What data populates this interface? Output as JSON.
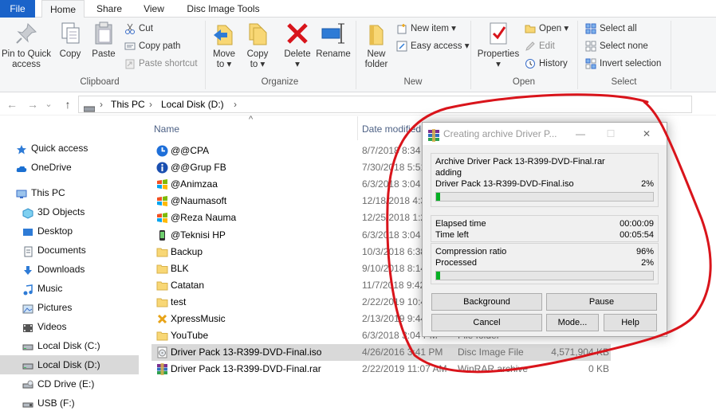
{
  "ribbon_tabs": [
    "File",
    "Home",
    "Share",
    "View",
    "Disc Image Tools"
  ],
  "clipboard": {
    "pin_line1": "Pin to Quick",
    "pin_line2": "access",
    "copy": "Copy",
    "paste": "Paste",
    "cut": "Cut",
    "copy_path": "Copy path",
    "paste_shortcut": "Paste shortcut",
    "label": "Clipboard"
  },
  "organize": {
    "move_line1": "Move",
    "move_line2": "to ▾",
    "copy_line1": "Copy",
    "copy_line2": "to ▾",
    "delete_line1": "Delete",
    "delete_line2": "▾",
    "rename": "Rename",
    "label": "Organize"
  },
  "new_group": {
    "folder_line1": "New",
    "folder_line2": "folder",
    "new_item": "New item ▾",
    "easy_access": "Easy access ▾",
    "label": "New"
  },
  "open_group": {
    "properties": "Properties",
    "properties_arrow": "▾",
    "open": "Open ▾",
    "edit": "Edit",
    "history": "History",
    "label": "Open"
  },
  "select_group": {
    "select_all": "Select all",
    "select_none": "Select none",
    "invert": "Invert selection",
    "label": "Select"
  },
  "address": {
    "back": "←",
    "forward": "→",
    "recent": "⌄",
    "up": "↑",
    "sep1": "›",
    "this_pc": "This PC",
    "sep2": "›",
    "local_disk": "Local Disk (D:)",
    "sep3": "›"
  },
  "nav": [
    {
      "label": "Quick access",
      "icon": "star-icon",
      "indent": 1
    },
    {
      "label": "OneDrive",
      "icon": "cloud-icon",
      "indent": 1
    },
    {
      "label": "This PC",
      "icon": "monitor-icon",
      "indent": 1
    },
    {
      "label": "3D Objects",
      "icon": "cube-icon",
      "indent": 2
    },
    {
      "label": "Desktop",
      "icon": "desktop-icon",
      "indent": 2
    },
    {
      "label": "Documents",
      "icon": "documents-icon",
      "indent": 2
    },
    {
      "label": "Downloads",
      "icon": "download-icon",
      "indent": 2
    },
    {
      "label": "Music",
      "icon": "music-icon",
      "indent": 2
    },
    {
      "label": "Pictures",
      "icon": "pictures-icon",
      "indent": 2
    },
    {
      "label": "Videos",
      "icon": "videos-icon",
      "indent": 2
    },
    {
      "label": "Local Disk (C:)",
      "icon": "drive-icon",
      "indent": 2
    },
    {
      "label": "Local Disk (D:)",
      "icon": "drive-icon",
      "indent": 2,
      "selected": true
    },
    {
      "label": "CD Drive (E:)",
      "icon": "cd-drive-icon",
      "indent": 2
    },
    {
      "label": "USB (F:)",
      "icon": "usb-drive-icon",
      "indent": 2
    }
  ],
  "columns": {
    "name": "Name",
    "date": "Date modified",
    "sort": "^"
  },
  "files": [
    {
      "name": "@@CPA",
      "date": "8/7/2018 8:34 P",
      "type": "",
      "size": "",
      "icon": "blue-link-icon"
    },
    {
      "name": "@@Grup FB",
      "date": "7/30/2018 5:51",
      "type": "",
      "size": "",
      "icon": "info-icon"
    },
    {
      "name": "@Animzaa",
      "date": "6/3/2018 3:04 P",
      "type": "",
      "size": "",
      "icon": "windows-logo-icon"
    },
    {
      "name": "@Naumasoft",
      "date": "12/18/2018 4:3",
      "type": "",
      "size": "",
      "icon": "windows-logo-icon"
    },
    {
      "name": "@Reza Nauma",
      "date": "12/25/2018 1:2",
      "type": "",
      "size": "",
      "icon": "windows-logo-icon"
    },
    {
      "name": "@Teknisi HP",
      "date": "6/3/2018 3:04 P",
      "type": "",
      "size": "",
      "icon": "phone-icon"
    },
    {
      "name": "Backup",
      "date": "10/3/2018 6:38",
      "type": "",
      "size": "",
      "icon": "folder-icon"
    },
    {
      "name": "BLK",
      "date": "9/10/2018 8:14",
      "type": "",
      "size": "",
      "icon": "folder-icon"
    },
    {
      "name": "Catatan",
      "date": "11/7/2018 9:42",
      "type": "",
      "size": "",
      "icon": "folder-icon"
    },
    {
      "name": "test",
      "date": "2/22/2019 10:4",
      "type": "",
      "size": "",
      "icon": "folder-icon"
    },
    {
      "name": "XpressMusic",
      "date": "2/13/2019 9:44",
      "type": "",
      "size": "",
      "icon": "music-app-icon"
    },
    {
      "name": "YouTube",
      "date": "6/3/2018 3:04 PM",
      "type": "File folder",
      "size": "",
      "icon": "folder-icon"
    },
    {
      "name": "Driver Pack 13-R399-DVD-Final.iso",
      "date": "4/26/2016 3:41 PM",
      "type": "Disc Image File",
      "size": "4,571,904 KB",
      "icon": "disc-image-icon",
      "selected": true
    },
    {
      "name": "Driver Pack 13-R399-DVD-Final.rar",
      "date": "2/22/2019 11:07 AM",
      "type": "WinRAR archive",
      "size": "0 KB",
      "icon": "winrar-icon"
    }
  ],
  "dialog": {
    "title": "Creating archive Driver P...",
    "minimize": "—",
    "maximize": "☐",
    "close": "✕",
    "archive_name": "Archive Driver Pack 13-R399-DVD-Final.rar",
    "action": "adding",
    "file": "Driver Pack 13-R399-DVD-Final.iso",
    "file_percent": "2%",
    "file_progress": 0.02,
    "elapsed_label": "Elapsed time",
    "elapsed": "00:00:09",
    "left_label": "Time left",
    "left": "00:05:54",
    "ratio_label": "Compression ratio",
    "ratio": "96%",
    "processed_label": "Processed",
    "processed": "2%",
    "total_progress": 0.02,
    "btn_background": "Background",
    "btn_pause": "Pause",
    "btn_cancel": "Cancel",
    "btn_mode": "Mode...",
    "btn_help": "Help"
  },
  "colors": {
    "file_tab": "#1a63c9",
    "progress": "#06b025",
    "annotation": "#d9141b",
    "selection": "#d9d9d9"
  }
}
